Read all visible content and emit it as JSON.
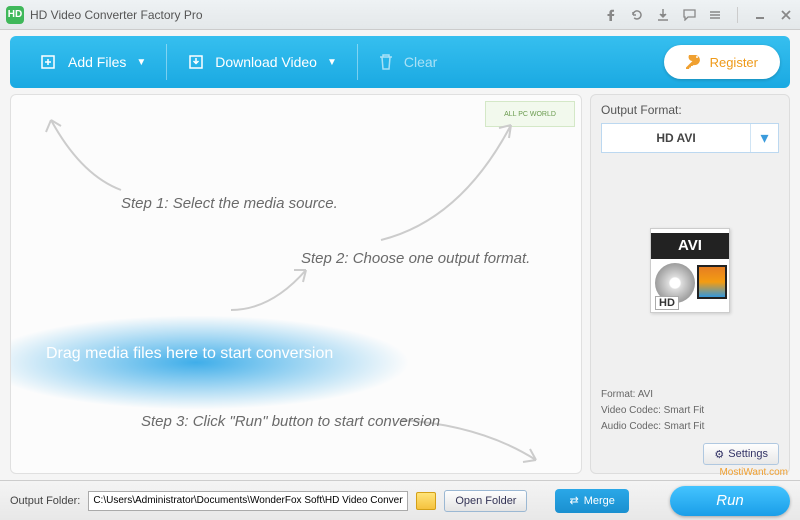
{
  "titlebar": {
    "title": "HD Video Converter Factory Pro"
  },
  "toolbar": {
    "add_files": "Add Files",
    "download_video": "Download Video",
    "clear": "Clear",
    "register": "Register"
  },
  "drop": {
    "step1": "Step 1: Select the media source.",
    "step2": "Step 2: Choose one output format.",
    "step3": "Step 3: Click \"Run\" button to start conversion",
    "hint": "Drag media files here to start conversion",
    "watermark": "ALL PC WORLD"
  },
  "side": {
    "title": "Output Format:",
    "selected": "HD AVI",
    "icon_avi": "AVI",
    "icon_hd": "HD",
    "format_label": "Format:",
    "format_value": "AVI",
    "video_codec_label": "Video Codec:",
    "video_codec_value": "Smart Fit",
    "audio_codec_label": "Audio Codec:",
    "audio_codec_value": "Smart Fit",
    "settings": "Settings"
  },
  "footer": {
    "label": "Output Folder:",
    "path": "C:\\Users\\Administrator\\Documents\\WonderFox Soft\\HD Video Converter Fac",
    "open": "Open Folder",
    "merge": "Merge",
    "run": "Run"
  },
  "brand": "MostiWant.com"
}
